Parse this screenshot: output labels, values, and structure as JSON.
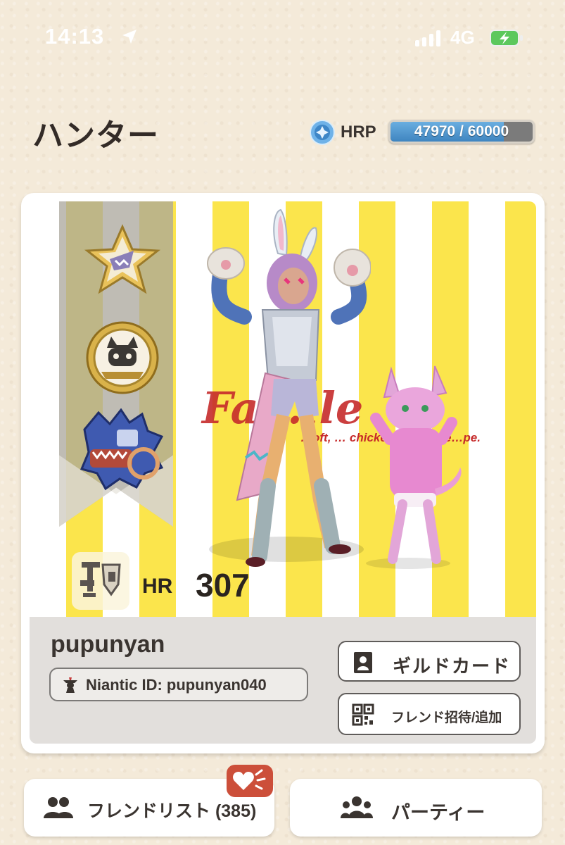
{
  "status_bar": {
    "time": "14:13",
    "network": "4G",
    "icons": [
      "location-arrow-icon",
      "signal-bars-icon",
      "battery-charging-icon"
    ]
  },
  "header": {
    "title": "ハンター",
    "hrp_label": "HRP",
    "hrp_value": "47970 / 60000",
    "hrp_progress": 0.7995,
    "hrp_icon": "hrp-crystal-icon"
  },
  "hunter_card": {
    "medals": [
      "star-medal-icon",
      "palico-coin-medal-icon",
      "monster-medal-icon"
    ],
    "background_sign": {
      "logo": "Fa…ile",
      "tagline": "…oft, … chicken. …bonele…pe."
    },
    "weapon_icon": "weapon-sns-icon",
    "hr_label": "HR",
    "hr_value": "307",
    "username": "pupunyan",
    "niantic_id": "Niantic ID: pupunyan040",
    "guild_card_label": "ギルドカード",
    "friend_invite_label": "フレンド招待/追加"
  },
  "bottom_nav": {
    "friend_list_label": "フレンドリスト (385)",
    "party_label": "パーティー",
    "badge_icon": "heart-badge-icon"
  },
  "colors": {
    "background": "#f4ead9",
    "stripe_yellow": "#fbe54c",
    "hrp_fill": "#4a90c8",
    "badge": "#cc4f3a"
  }
}
